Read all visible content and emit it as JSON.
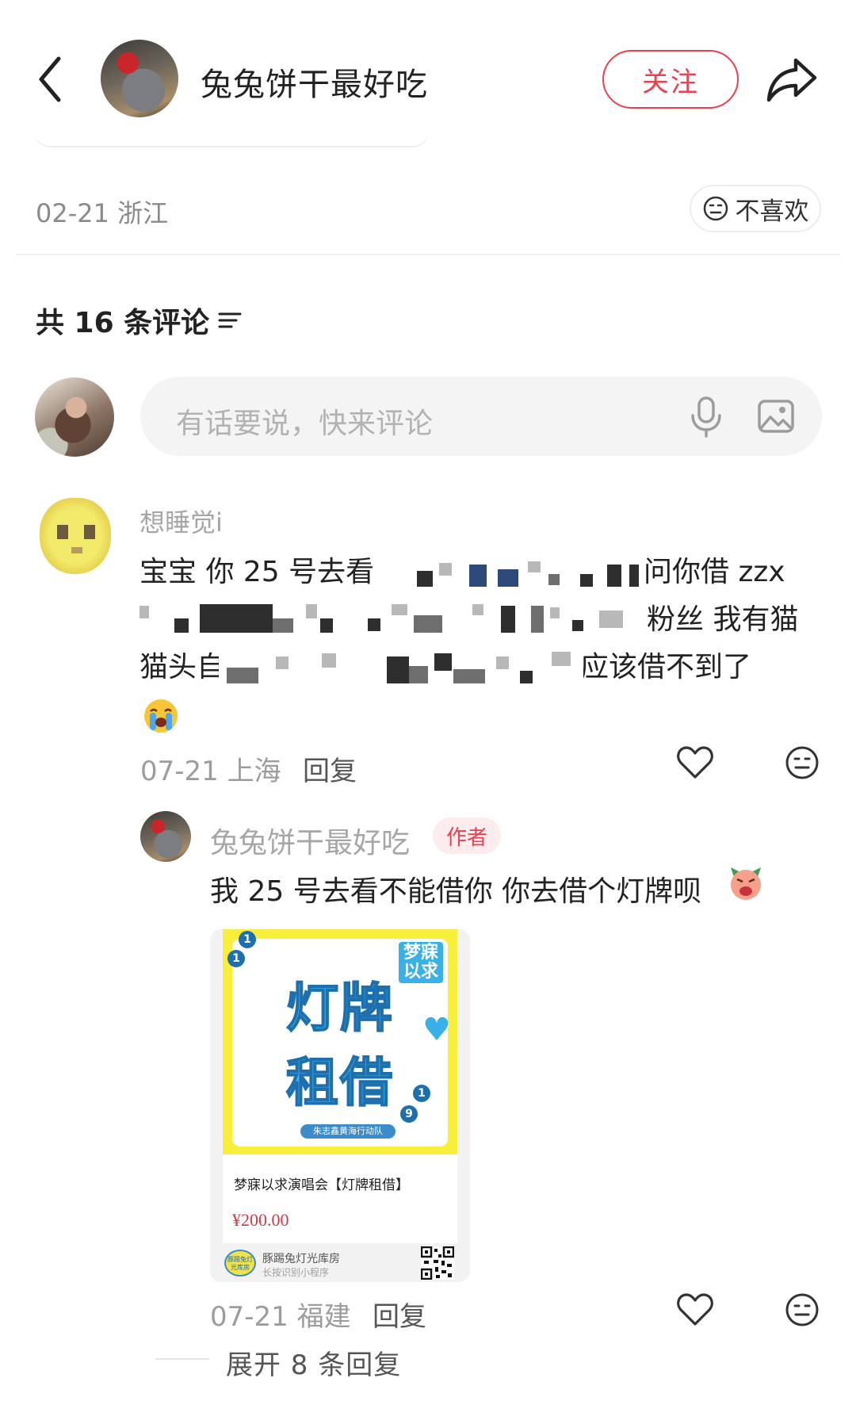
{
  "header": {
    "author_name": "兔兔饼干最好吃",
    "follow_label": "关注"
  },
  "post": {
    "meta": "02-21 浙江",
    "dislike_label": "不喜欢"
  },
  "comments_section": {
    "count_label": "共 16 条评论",
    "input_placeholder": "有话要说，快来评论"
  },
  "comments": [
    {
      "username": "想睡觉i",
      "lines": [
        "宝宝 你 25 号去看",
        "问你借 zzx",
        "粉丝 我有猫",
        "猫头自己买的 灯牌",
        "应该借不到了"
      ],
      "meta": "07-21 上海",
      "reply_label": "回复",
      "replies": [
        {
          "username": "兔兔饼干最好吃",
          "badge": "作者",
          "text": "我 25 号去看不能借你 你去借个灯牌呗",
          "product": {
            "poster_tag": "梦寐以求",
            "poster_title_1": "灯牌",
            "poster_title_2": "租借",
            "poster_team": "朱志鑫黄海行动队",
            "title": "梦寐以求演唱会【灯牌租借】",
            "price": "¥200.00",
            "store_logo": "豚踢兔灯光库房",
            "store_name": "豚踢兔灯光库房",
            "store_hint": "长按识别小程序"
          },
          "meta": "07-21 福建",
          "reply_label": "回复"
        }
      ],
      "expand_label": "展开 8 条回复"
    }
  ],
  "colors": {
    "accent": "#e8414f",
    "placeholder": "#b2b2b2",
    "meta": "#9c9c9c"
  },
  "icons": [
    "back-icon",
    "share-icon",
    "neutral-face-icon",
    "filter-icon",
    "mic-icon",
    "image-icon",
    "heart-icon",
    "crying-emoji-icon",
    "angry-emoji-icon",
    "qr-code-icon"
  ]
}
